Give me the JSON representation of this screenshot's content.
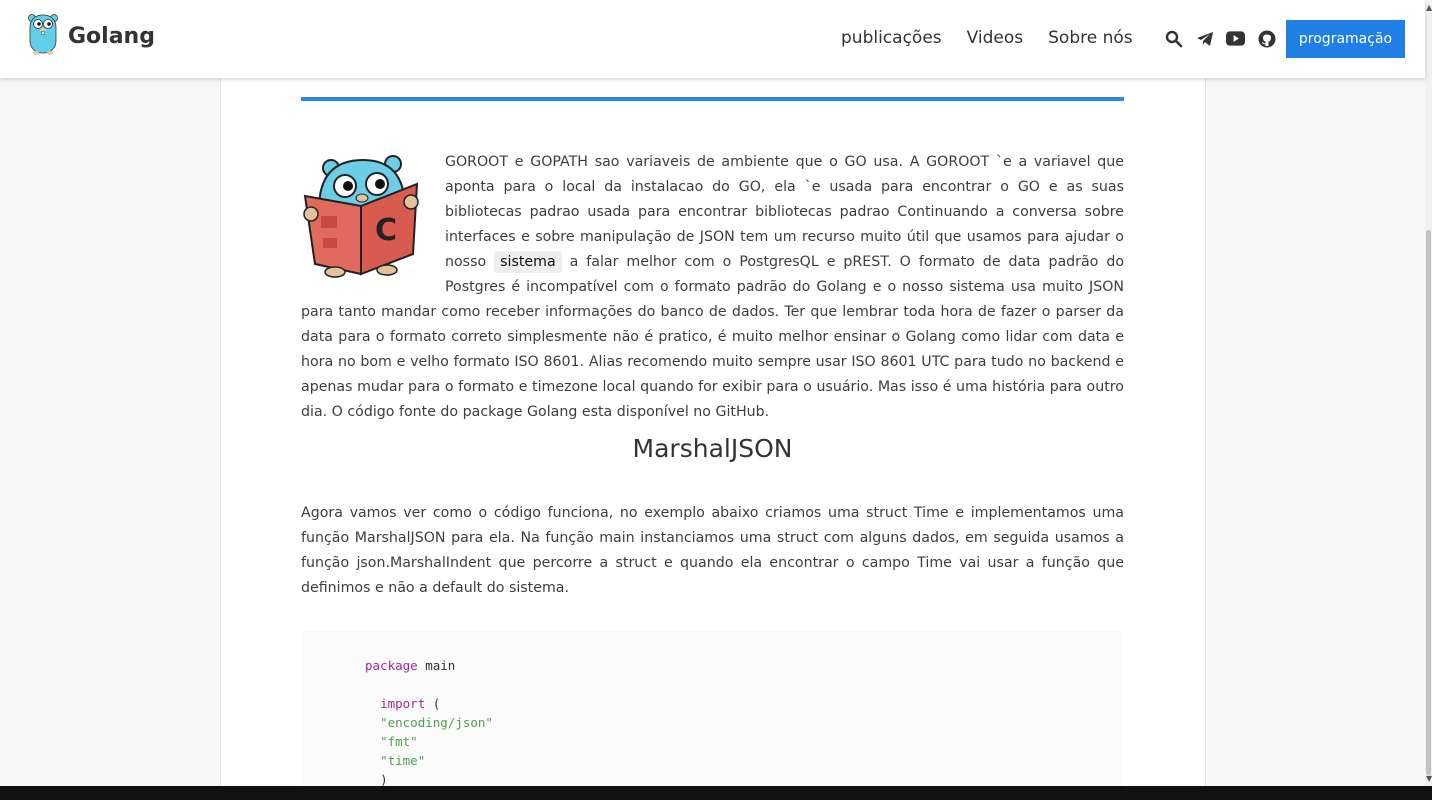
{
  "header": {
    "brand": "Golang",
    "nav": [
      "publicações",
      "Videos",
      "Sobre nós"
    ],
    "icons": [
      "search-icon",
      "telegram-icon",
      "youtube-icon",
      "github-icon"
    ],
    "cta": "programação",
    "accent": "#1f7fe6"
  },
  "article": {
    "intro_before": "GOROOT e GOPATH sao variaveis de ambiente que o GO usa. A GOROOT `e a variavel que aponta para o local da instalacao do GO, ela `e usada para encontrar o GO e as suas bibliotecas padrao usada para encontrar bibliotecas padrao Continuando a conversa sobre interfaces e sobre manipulação de JSON tem um recurso muito útil que usamos para ajudar o nosso",
    "intro_code": "sistema",
    "intro_after": "a falar melhor com o PostgresQL e pREST. O formato de data padrão do Postgres é incompatível com o formato padrão do Golang e o nosso sistema usa muito JSON para tanto mandar como receber informações do banco de dados. Ter que lembrar toda hora de fazer o parser da data para o formato correto simplesmente não é pratico, é muito melhor ensinar o Golang como lidar com data e hora no bom e velho formato ISO 8601. Alias recomendo muito sempre usar ISO 8601 UTC para tudo no backend e apenas mudar para o formato e timezone local quando for exibir para o usuário. Mas isso é uma história para outro dia. O código fonte do package Golang esta disponível no GitHub.",
    "section_title": "MarshalJSON",
    "paragraph2": "Agora vamos ver como o código funciona, no exemplo abaixo criamos uma struct Time e implementamos uma função MarshalJSON para ela. Na função main instanciamos uma struct com alguns dados, em seguida usamos a função json.MarshalIndent que percorre a struct e quando ela encontrar o campo Time vai usar a função que definimos e não a default do sistema.",
    "code": {
      "kw_package": "package",
      "pkg_name": "main",
      "kw_import": "import",
      "open_paren": "(",
      "imports": [
        "\"encoding/json\"",
        "\"fmt\"",
        "\"time\""
      ],
      "close_paren": ")"
    }
  }
}
